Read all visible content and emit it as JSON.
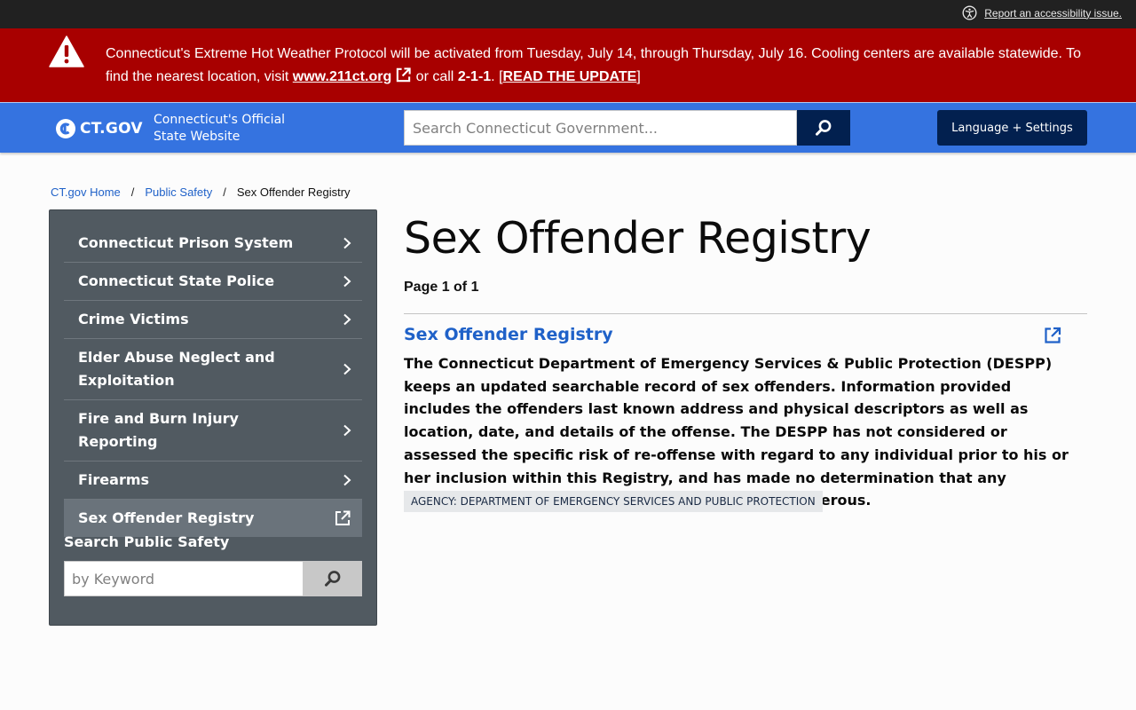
{
  "utility": {
    "accessibility_link": "Report an accessibility issue."
  },
  "alert": {
    "text_before": "Connecticut's Extreme Hot Weather Protocol will be activated from Tuesday, July 14, through Thursday, July 16. Cooling centers are available statewide. To find the nearest location, visit ",
    "link": "www.211ct.org",
    "text_middle": " or call ",
    "phone": "2-1-1",
    "text_after_phone": ". [",
    "update_link": "READ THE UPDATE",
    "text_end": "]",
    "background": "#a80000"
  },
  "header": {
    "logo_text": "CT.GOV",
    "official_line1": "Connecticut's Official",
    "official_line2": "State Website",
    "search_placeholder": "Search Connecticut Government...",
    "language_button": "Language + Settings",
    "background": "#3573e0",
    "dark_accent": "#02204f"
  },
  "breadcrumb": {
    "items": [
      {
        "label": "CT.gov Home"
      },
      {
        "label": "Public Safety"
      }
    ],
    "separator": "/",
    "current": "Sex Offender Registry"
  },
  "sidebar": {
    "items": [
      {
        "label": "Connecticut Prison System",
        "icon": "chevron-right-icon"
      },
      {
        "label": "Connecticut State Police",
        "icon": "chevron-right-icon"
      },
      {
        "label": "Crime Victims",
        "icon": "chevron-right-icon"
      },
      {
        "label": "Elder Abuse Neglect and Exploitation",
        "icon": "chevron-right-icon"
      },
      {
        "label": "Fire and Burn Injury Reporting",
        "icon": "chevron-right-icon"
      },
      {
        "label": "Firearms",
        "icon": "chevron-right-icon"
      },
      {
        "label": "Sex Offender Registry",
        "icon": "external-link-icon",
        "active": true
      }
    ],
    "search_label": "Search Public Safety",
    "search_placeholder": "by Keyword"
  },
  "main": {
    "title": "Sex Offender Registry",
    "page_count": "Page 1 of 1",
    "result": {
      "title": "Sex Offender Registry",
      "description": "The Connecticut Department of Emergency Services & Public Protection (DESPP) keeps an updated searchable record of sex offenders. Information provided includes the offenders last known address and physical descriptors as well as location, date, and details of the offense. The DESPP has not considered or assessed the specific risk of re-offense with regard to any individual prior to his or her inclusion within this Registry, and has made no determination that any individual included in the Registry is currently dangerous.",
      "agency": "Agency: Department of Emergency Services and Public Protection"
    }
  }
}
